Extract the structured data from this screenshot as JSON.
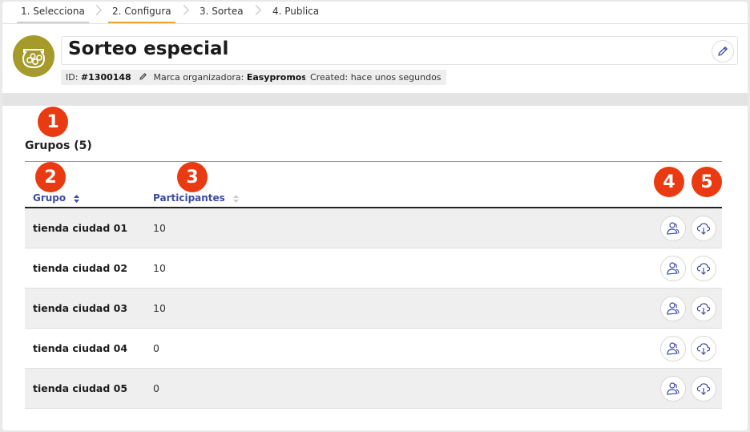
{
  "steps": [
    {
      "label": "1. Selecciona",
      "state": "done"
    },
    {
      "label": "2. Configura",
      "state": "active"
    },
    {
      "label": "3. Sortea",
      "state": "pending"
    },
    {
      "label": "4. Publica",
      "state": "pending"
    }
  ],
  "header": {
    "title": "Sorteo especial",
    "id_label": "ID:",
    "id_value": "#1300148",
    "brand_label": "Marca organizadora:",
    "brand_value": "Easypromos",
    "created": "Created: hace unos segundos"
  },
  "badges": [
    "1",
    "2",
    "3",
    "4",
    "5"
  ],
  "section": {
    "title": "Grupos (5)"
  },
  "table": {
    "headers": [
      "Grupo",
      "Participantes"
    ],
    "rows": [
      {
        "group": "tienda ciudad 01",
        "participants": "10"
      },
      {
        "group": "tienda ciudad 02",
        "participants": "10"
      },
      {
        "group": "tienda ciudad 03",
        "participants": "10"
      },
      {
        "group": "tienda ciudad 04",
        "participants": "0"
      },
      {
        "group": "tienda ciudad 05",
        "participants": "0"
      }
    ]
  },
  "colors": {
    "active_step": "#f0a23a",
    "avatar": "#a59a2a",
    "badge": "#ea3a11",
    "link": "#3b4ba6"
  },
  "icons": {
    "row_action_1": "users-icon",
    "row_action_2": "cloud-download-icon",
    "edit": "pencil-icon"
  }
}
